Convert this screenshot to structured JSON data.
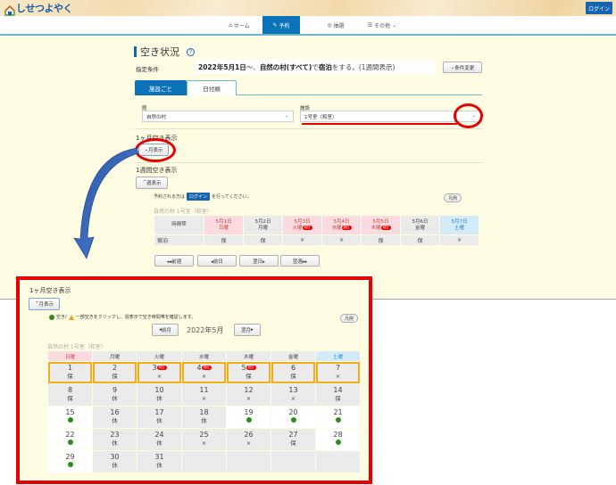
{
  "header": {
    "logo_text": "しせつよやく",
    "login_label": "ログイン"
  },
  "nav": {
    "items": [
      {
        "icon": "home-icon",
        "label": "ホーム"
      },
      {
        "icon": "edit-icon",
        "label": "予約",
        "active": true
      },
      {
        "icon": "lottery-icon",
        "label": "抽選"
      },
      {
        "icon": "menu-icon",
        "label": "その他"
      }
    ]
  },
  "page": {
    "title": "空き状況",
    "condition_label": "指定条件",
    "condition": {
      "date": "2022年5月1日",
      "sep1": "～、",
      "place": "自然の村(すべて)",
      "mid": "で",
      "purpose": "宿泊",
      "tail": "をする。(1週間表示)"
    },
    "change_button": "条件変更",
    "tabs": [
      "施設ごと",
      "日付順"
    ],
    "hall_label": "館",
    "hall_value": "自然の村",
    "facility_label": "施設",
    "facility_value": "1号室（和室）"
  },
  "month_section": {
    "title": "1ヶ月空き表示",
    "toggle_label": "月表示"
  },
  "week_section": {
    "title": "1週間空き表示",
    "toggle_label": "週表示",
    "login_note_pre": "予約される方は",
    "login_note_btn": "ログイン",
    "login_note_post": "を行ってください。",
    "legend_label": "凡例",
    "facility_name": "自然の村 1号室（和室）",
    "row_header": "時間帯",
    "days": [
      {
        "date": "5月1日",
        "dow": "日曜",
        "type": "sun",
        "holiday": false
      },
      {
        "date": "5月2日",
        "dow": "月曜",
        "type": "normal",
        "holiday": false
      },
      {
        "date": "5月3日",
        "dow": "火曜",
        "type": "hol",
        "holiday": true
      },
      {
        "date": "5月4日",
        "dow": "水曜",
        "type": "hol",
        "holiday": true
      },
      {
        "date": "5月5日",
        "dow": "木曜",
        "type": "hol",
        "holiday": true
      },
      {
        "date": "5月6日",
        "dow": "金曜",
        "type": "normal",
        "holiday": false
      },
      {
        "date": "5月7日",
        "dow": "土曜",
        "type": "sat",
        "holiday": false
      }
    ],
    "holiday_badge": "祝日",
    "rows": [
      {
        "slot": "宿泊",
        "values": [
          "保",
          "保",
          "×",
          "×",
          "保",
          "保",
          "×"
        ]
      }
    ],
    "nav_buttons": {
      "prev_week": "◂◂前週",
      "prev_day": "◂前日",
      "next_day": "翌日▸",
      "next_week": "翌週▸▸"
    }
  },
  "month_panel": {
    "title": "1ヶ月空き表示",
    "toggle_label": "月表示",
    "note_avail": "空き/",
    "note_rest": "一部空きをクリックし、週表示で空き時間帯を確認します。",
    "legend_label": "凡例",
    "prev_label": "前月",
    "month_label": "2022年5月",
    "next_label": "翌月",
    "facility_name": "自然の村 1号室（和室）",
    "weekdays": [
      "日曜",
      "月曜",
      "火曜",
      "水曜",
      "木曜",
      "金曜",
      "土曜"
    ],
    "holiday_badge": "祝日",
    "weeks": [
      [
        {
          "d": "1",
          "s": "保"
        },
        {
          "d": "2",
          "s": "保"
        },
        {
          "d": "3",
          "s": "×",
          "hol": true
        },
        {
          "d": "4",
          "s": "×",
          "hol": true
        },
        {
          "d": "5",
          "s": "保",
          "hol": true
        },
        {
          "d": "6",
          "s": "保"
        },
        {
          "d": "7",
          "s": "×"
        }
      ],
      [
        {
          "d": "8",
          "s": "保"
        },
        {
          "d": "9",
          "s": "休"
        },
        {
          "d": "10",
          "s": "休"
        },
        {
          "d": "11",
          "s": "×"
        },
        {
          "d": "12",
          "s": "×"
        },
        {
          "d": "13",
          "s": "×"
        },
        {
          "d": "14",
          "s": "保"
        }
      ],
      [
        {
          "d": "15",
          "s": "●"
        },
        {
          "d": "16",
          "s": "休"
        },
        {
          "d": "17",
          "s": "休"
        },
        {
          "d": "18",
          "s": "休"
        },
        {
          "d": "19",
          "s": "●"
        },
        {
          "d": "20",
          "s": "●"
        },
        {
          "d": "21",
          "s": "●"
        }
      ],
      [
        {
          "d": "22",
          "s": "●"
        },
        {
          "d": "23",
          "s": "休"
        },
        {
          "d": "24",
          "s": "休"
        },
        {
          "d": "25",
          "s": "×"
        },
        {
          "d": "26",
          "s": "×"
        },
        {
          "d": "27",
          "s": "保"
        },
        {
          "d": "28",
          "s": "●"
        }
      ],
      [
        {
          "d": "29",
          "s": "●"
        },
        {
          "d": "30",
          "s": "休"
        },
        {
          "d": "31",
          "s": "休"
        },
        {
          "d": "",
          "s": ""
        },
        {
          "d": "",
          "s": ""
        },
        {
          "d": "",
          "s": ""
        },
        {
          "d": "",
          "s": ""
        }
      ]
    ]
  },
  "colors": {
    "brand_blue": "#0d73b8",
    "highlight_red": "#e60000",
    "week_highlight": "#f0ad1e",
    "available_green": "#2e8b1e",
    "partial_orange": "#f0a020"
  }
}
